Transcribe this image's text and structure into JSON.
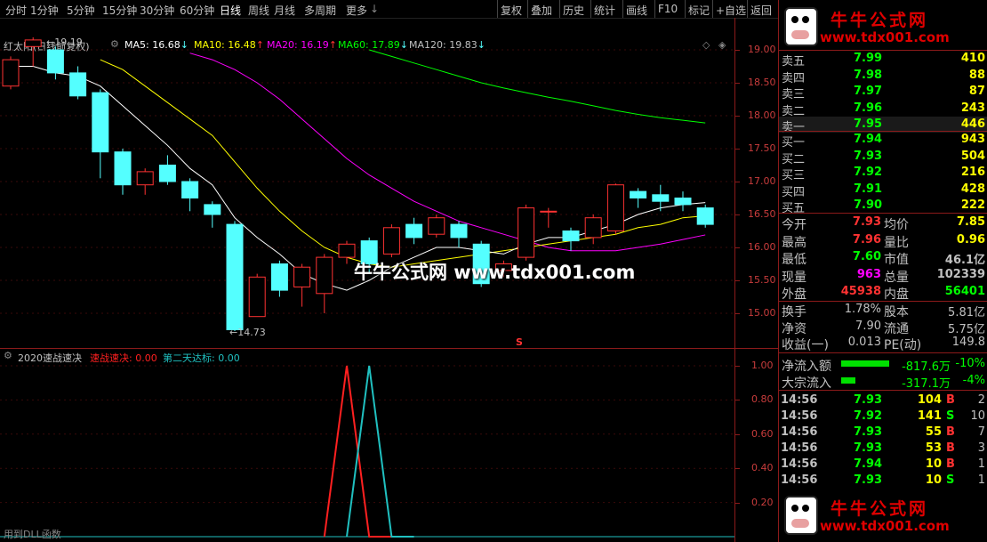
{
  "toolbar": {
    "periods": [
      "分时",
      "1分钟",
      "5分钟",
      "15分钟",
      "30分钟",
      "60分钟",
      "日线",
      "周线",
      "月线",
      "多周期",
      "更多"
    ],
    "active_period": "日线",
    "more_arrow": "↓",
    "right_buttons": [
      "复权",
      "叠加",
      "历史",
      "统计",
      "画线",
      "F10",
      "标记",
      "+自选",
      "返回"
    ]
  },
  "chart_header": {
    "stock": "红太阳(日线前复权)",
    "ma5": "MA5: 16.68",
    "ma5_arrow": "↓",
    "ma10": "MA10: 16.48",
    "ma10_arrow": "↑",
    "ma20": "MA20: 16.19",
    "ma20_arrow": "↑",
    "ma60": "MA60: 17.89",
    "ma60_arrow": "↓",
    "ma120": "MA120: 19.83",
    "ma120_arrow": "↓",
    "colors": {
      "ma5": "#ffffff",
      "ma10": "#ffff00",
      "ma20": "#ff00ff",
      "ma60": "#00ff00",
      "ma120": "#c0c0c0",
      "up": "#ff3232",
      "down": "#54ffff"
    }
  },
  "price_axis": [
    "19.00",
    "18.50",
    "18.00",
    "17.50",
    "17.00",
    "16.50",
    "16.00",
    "15.50",
    "15.00"
  ],
  "annotations": {
    "high_label": "19.19",
    "low_label": "14.73",
    "s_marker": "S"
  },
  "watermark": "牛牛公式网 www.tdx001.com",
  "indicator": {
    "name": "2020速战速决",
    "line1": "速战速决: 0.00",
    "line2": "第二天达标: 0.00",
    "axis": [
      "1.00",
      "0.80",
      "0.60",
      "0.40",
      "0.20"
    ],
    "footer": "用到DLL函数"
  },
  "chart_data": [
    {
      "type": "candlestick",
      "title": "红太阳(日线前复权)",
      "ylim": [
        14.5,
        19.5
      ],
      "candles": [
        {
          "o": 18.45,
          "c": 18.85,
          "h": 18.9,
          "l": 18.4
        },
        {
          "o": 19.05,
          "c": 19.15,
          "h": 19.19,
          "l": 18.75
        },
        {
          "o": 19.0,
          "c": 18.65,
          "h": 19.05,
          "l": 18.55
        },
        {
          "o": 18.65,
          "c": 18.3,
          "h": 18.75,
          "l": 18.25
        },
        {
          "o": 18.35,
          "c": 17.45,
          "h": 18.4,
          "l": 17.05
        },
        {
          "o": 17.45,
          "c": 16.95,
          "h": 17.5,
          "l": 16.8
        },
        {
          "o": 16.95,
          "c": 17.15,
          "h": 17.2,
          "l": 16.8
        },
        {
          "o": 17.25,
          "c": 17.0,
          "h": 17.4,
          "l": 16.95
        },
        {
          "o": 17.0,
          "c": 16.75,
          "h": 17.05,
          "l": 16.55
        },
        {
          "o": 16.65,
          "c": 16.5,
          "h": 16.7,
          "l": 16.3
        },
        {
          "o": 16.35,
          "c": 14.75,
          "h": 16.4,
          "l": 14.73
        },
        {
          "o": 14.95,
          "c": 15.55,
          "h": 15.6,
          "l": 14.95
        },
        {
          "o": 15.75,
          "c": 15.35,
          "h": 15.8,
          "l": 15.25
        },
        {
          "o": 15.4,
          "c": 15.7,
          "h": 15.75,
          "l": 15.1
        },
        {
          "o": 15.3,
          "c": 15.85,
          "h": 15.9,
          "l": 15.0
        },
        {
          "o": 15.85,
          "c": 16.05,
          "h": 16.1,
          "l": 15.75
        },
        {
          "o": 16.1,
          "c": 15.75,
          "h": 16.15,
          "l": 15.6
        },
        {
          "o": 15.9,
          "c": 16.3,
          "h": 16.35,
          "l": 15.85
        },
        {
          "o": 16.35,
          "c": 16.15,
          "h": 16.45,
          "l": 16.05
        },
        {
          "o": 16.2,
          "c": 16.45,
          "h": 16.5,
          "l": 16.15
        },
        {
          "o": 16.35,
          "c": 16.15,
          "h": 16.4,
          "l": 16.0
        },
        {
          "o": 16.05,
          "c": 15.45,
          "h": 16.1,
          "l": 15.4
        },
        {
          "o": 15.65,
          "c": 15.75,
          "h": 15.8,
          "l": 15.55
        },
        {
          "o": 15.85,
          "c": 16.6,
          "h": 16.65,
          "l": 15.8
        },
        {
          "o": 16.55,
          "c": 16.55,
          "h": 16.6,
          "l": 16.3
        },
        {
          "o": 16.25,
          "c": 16.1,
          "h": 16.3,
          "l": 15.95
        },
        {
          "o": 16.15,
          "c": 16.45,
          "h": 16.5,
          "l": 16.05
        },
        {
          "o": 16.25,
          "c": 16.95,
          "h": 16.97,
          "l": 16.2
        },
        {
          "o": 16.85,
          "c": 16.75,
          "h": 16.9,
          "l": 16.6
        },
        {
          "o": 16.8,
          "c": 16.7,
          "h": 16.95,
          "l": 16.55
        },
        {
          "o": 16.75,
          "c": 16.65,
          "h": 16.85,
          "l": 16.55
        },
        {
          "o": 16.6,
          "c": 16.35,
          "h": 16.65,
          "l": 16.3
        }
      ],
      "ma5": [
        18.75,
        18.75,
        18.65,
        18.6,
        18.45,
        18.15,
        17.85,
        17.55,
        17.2,
        16.95,
        16.45,
        16.15,
        15.9,
        15.6,
        15.45,
        15.35,
        15.5,
        15.7,
        15.85,
        16.0,
        16.0,
        15.95,
        15.9,
        16.05,
        16.15,
        16.15,
        16.25,
        16.35,
        16.5,
        16.6,
        16.65,
        16.68
      ],
      "ma10": [
        null,
        null,
        null,
        null,
        18.85,
        18.7,
        18.45,
        18.2,
        17.95,
        17.7,
        17.3,
        16.9,
        16.55,
        16.25,
        16.0,
        15.85,
        15.75,
        15.7,
        15.75,
        15.8,
        15.85,
        15.9,
        15.95,
        16.0,
        16.05,
        16.1,
        16.15,
        16.2,
        16.3,
        16.35,
        16.45,
        16.48
      ],
      "ma20": [
        null,
        null,
        null,
        null,
        null,
        null,
        null,
        null,
        18.95,
        18.85,
        18.7,
        18.5,
        18.25,
        17.95,
        17.65,
        17.35,
        17.1,
        16.9,
        16.7,
        16.55,
        16.4,
        16.3,
        16.2,
        16.1,
        16.0,
        15.95,
        15.95,
        15.95,
        16.0,
        16.05,
        16.12,
        16.19
      ],
      "ma60": [
        null,
        null,
        null,
        null,
        null,
        null,
        null,
        null,
        null,
        null,
        null,
        null,
        null,
        null,
        null,
        null,
        19.0,
        18.9,
        18.8,
        18.7,
        18.6,
        18.5,
        18.42,
        18.35,
        18.28,
        18.22,
        18.15,
        18.08,
        18.02,
        17.97,
        17.93,
        17.89
      ]
    },
    {
      "type": "line",
      "title": "2020速战速决",
      "ylim": [
        0,
        1.1
      ],
      "series": [
        {
          "name": "速战速决",
          "color": "#ff2020",
          "x": [
            14.0,
            15.0,
            16.0,
            17.0
          ],
          "values": [
            0,
            1,
            0,
            0
          ]
        },
        {
          "name": "第二天达标",
          "color": "#20c0c0",
          "x": [
            15.0,
            16.0,
            17.0,
            18.0
          ],
          "values": [
            0,
            1,
            0,
            0
          ]
        }
      ]
    }
  ],
  "panel": {
    "logo_top": {
      "cn": "牛牛公式网",
      "url": "www.tdx001.com"
    },
    "logo_bottom": {
      "cn": "牛牛公式网",
      "url": "www.tdx001.com"
    },
    "sell": [
      {
        "label": "卖五",
        "price": "7.99",
        "vol": "410"
      },
      {
        "label": "卖四",
        "price": "7.98",
        "vol": "88"
      },
      {
        "label": "卖三",
        "price": "7.97",
        "vol": "87"
      },
      {
        "label": "卖二",
        "price": "7.96",
        "vol": "243"
      },
      {
        "label": "卖一",
        "price": "7.95",
        "vol": "446"
      }
    ],
    "buy": [
      {
        "label": "买一",
        "price": "7.94",
        "vol": "943"
      },
      {
        "label": "买二",
        "price": "7.93",
        "vol": "504"
      },
      {
        "label": "买三",
        "price": "7.92",
        "vol": "216"
      },
      {
        "label": "买四",
        "price": "7.91",
        "vol": "428"
      },
      {
        "label": "买五",
        "price": "7.90",
        "vol": "222"
      }
    ],
    "stats": [
      {
        "l1": "今开",
        "v1": "7.93",
        "l2": "均价",
        "v2": "7.85",
        "c1": "#ff3232",
        "c2": "#ffff00"
      },
      {
        "l1": "最高",
        "v1": "7.96",
        "l2": "量比",
        "v2": "0.96",
        "c1": "#ff3232",
        "c2": "#ffff00"
      },
      {
        "l1": "最低",
        "v1": "7.60",
        "l2": "市值",
        "v2": "46.1亿",
        "c1": "#00ff00",
        "c2": "#c0c0c0"
      },
      {
        "l1": "现量",
        "v1": "963",
        "l2": "总量",
        "v2": "102339",
        "c1": "#ff00ff",
        "c2": "#c0c0c0"
      },
      {
        "l1": "外盘",
        "v1": "45938",
        "l2": "内盘",
        "v2": "56401",
        "c1": "#ff3232",
        "c2": "#00ff00"
      }
    ],
    "stats2": [
      {
        "l1": "换手",
        "v1": "1.78%",
        "l2": "股本",
        "v2": "5.81亿"
      },
      {
        "l1": "净资",
        "v1": "7.90",
        "l2": "流通",
        "v2": "5.75亿"
      },
      {
        "l1": "收益(一)",
        "v1": "0.013",
        "l2": "PE(动)",
        "v2": "149.8"
      }
    ],
    "flows": [
      {
        "label": "净流入额",
        "amount": "-817.6万",
        "pct": "-10%",
        "bar": 0.85
      },
      {
        "label": "大宗流入",
        "amount": "-317.1万",
        "pct": "-4%",
        "bar": 0.25
      }
    ],
    "ticks": [
      {
        "time": "14:56",
        "price": "7.93",
        "vol": "104",
        "bs": "B",
        "n": "2"
      },
      {
        "time": "14:56",
        "price": "7.92",
        "vol": "141",
        "bs": "S",
        "n": "10"
      },
      {
        "time": "14:56",
        "price": "7.93",
        "vol": "55",
        "bs": "B",
        "n": "7"
      },
      {
        "time": "14:56",
        "price": "7.93",
        "vol": "53",
        "bs": "B",
        "n": "3"
      },
      {
        "time": "14:56",
        "price": "7.94",
        "vol": "10",
        "bs": "B",
        "n": "1"
      },
      {
        "time": "14:56",
        "price": "7.93",
        "vol": "10",
        "bs": "S",
        "n": "1"
      }
    ]
  }
}
